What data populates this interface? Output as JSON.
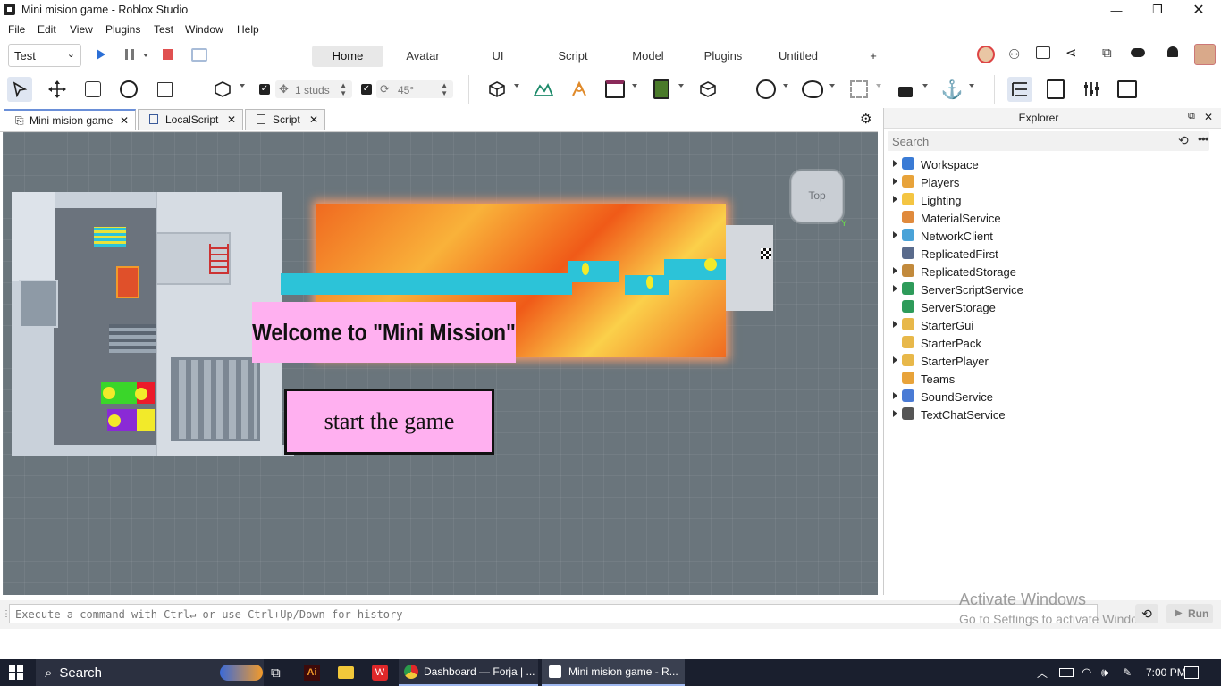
{
  "window": {
    "title": "Mini mision game - Roblox Studio"
  },
  "menu": [
    "File",
    "Edit",
    "View",
    "Plugins",
    "Test",
    "Window",
    "Help"
  ],
  "toolbar": {
    "mode_select": "Test",
    "ribbon_tabs": [
      "Home",
      "Avatar",
      "UI",
      "Script",
      "Model",
      "Plugins",
      "Untitled"
    ],
    "add_tab": "+",
    "move_value": "1 studs",
    "rotate_value": "45°"
  },
  "doc_tabs": [
    {
      "label": "Mini mision game",
      "close": "✕"
    },
    {
      "label": "LocalScript",
      "close": "✕"
    },
    {
      "label": "Script",
      "close": "✕"
    }
  ],
  "viewport": {
    "view_cube": "Top",
    "axis_label": "Y",
    "welcome_text": "Welcome to \"Mini Mission\"",
    "start_button": "start the game"
  },
  "explorer": {
    "title": "Explorer",
    "search_placeholder": "Search",
    "items": [
      {
        "label": "Workspace",
        "icon": "globe-icon",
        "color": "#3a7bd5",
        "expand": true
      },
      {
        "label": "Players",
        "icon": "players-icon",
        "color": "#e8a33a",
        "expand": true
      },
      {
        "label": "Lighting",
        "icon": "bulb-icon",
        "color": "#f4c542",
        "expand": true
      },
      {
        "label": "MaterialService",
        "icon": "material-icon",
        "color": "#e08a3c",
        "expand": false
      },
      {
        "label": "NetworkClient",
        "icon": "network-icon",
        "color": "#4aa3d8",
        "expand": true
      },
      {
        "label": "ReplicatedFirst",
        "icon": "replicated-first-icon",
        "color": "#5a6b8c",
        "expand": false
      },
      {
        "label": "ReplicatedStorage",
        "icon": "replicated-storage-icon",
        "color": "#c28a3c",
        "expand": true
      },
      {
        "label": "ServerScriptService",
        "icon": "server-script-icon",
        "color": "#2e9b5a",
        "expand": true
      },
      {
        "label": "ServerStorage",
        "icon": "server-storage-icon",
        "color": "#2e9b5a",
        "expand": false
      },
      {
        "label": "StarterGui",
        "icon": "folder-icon",
        "color": "#e8b84a",
        "expand": true
      },
      {
        "label": "StarterPack",
        "icon": "folder-icon",
        "color": "#e8b84a",
        "expand": false
      },
      {
        "label": "StarterPlayer",
        "icon": "folder-icon",
        "color": "#e8b84a",
        "expand": true
      },
      {
        "label": "Teams",
        "icon": "teams-icon",
        "color": "#e8a33a",
        "expand": false
      },
      {
        "label": "SoundService",
        "icon": "sound-icon",
        "color": "#4a7bd5",
        "expand": true
      },
      {
        "label": "TextChatService",
        "icon": "chat-icon",
        "color": "#555555",
        "expand": true
      }
    ]
  },
  "command_bar": {
    "placeholder": "Execute a command with Ctrl↵ or use Ctrl+Up/Down for history",
    "run_label": "Run",
    "watermark_title": "Activate Windows",
    "watermark_sub": "Go to Settings to activate Windows."
  },
  "taskbar": {
    "search_label": "Search",
    "apps": [
      "Dashboard — Forja | ...",
      "Mini mision game - R..."
    ],
    "time": "7:00 PM"
  },
  "colors": {
    "accent": "#6a8fd8",
    "banner_pink": "#ffb0f0",
    "lava_orange": "#f7782a",
    "platform_cyan": "#2cc3d8"
  }
}
